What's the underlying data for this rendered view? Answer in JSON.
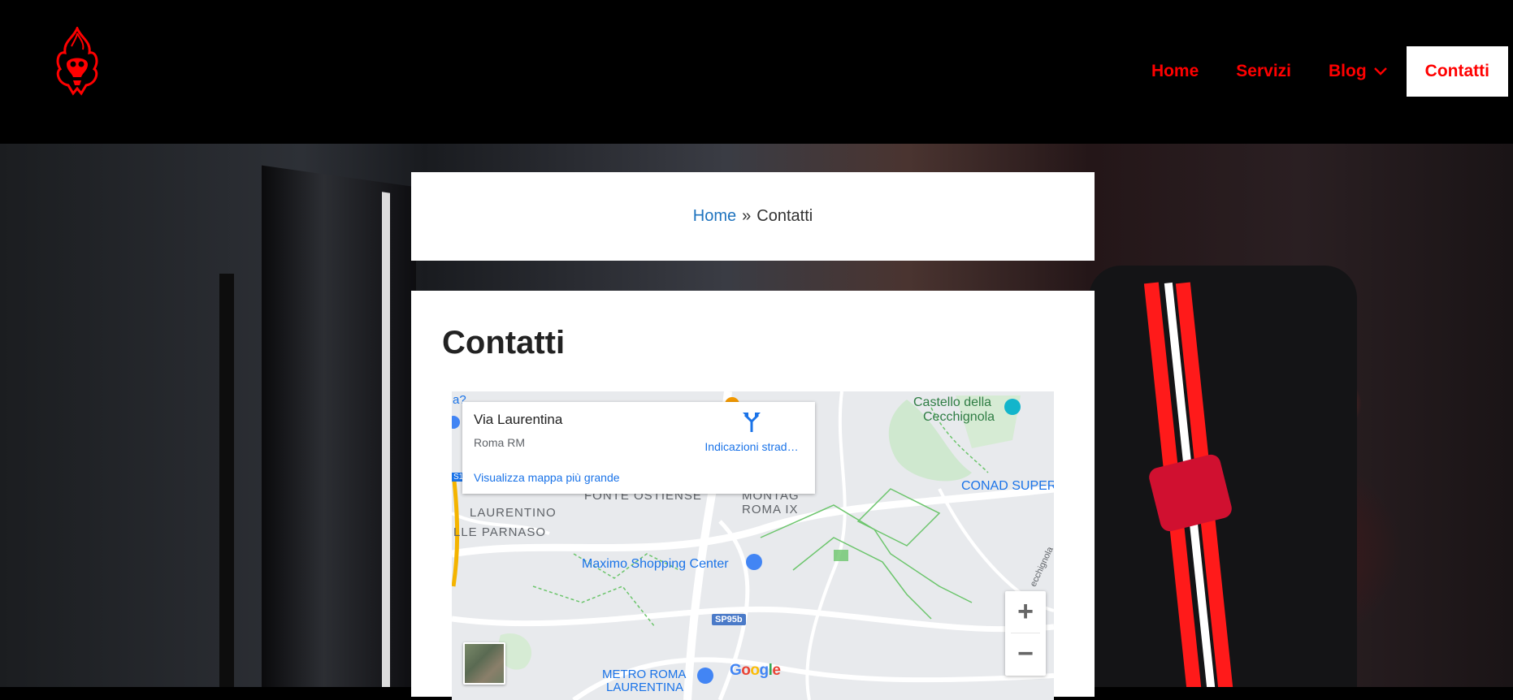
{
  "header": {
    "logo_icon": "flame-skull-logo-icon",
    "nav": {
      "home": "Home",
      "servizi": "Servizi",
      "blog": "Blog",
      "contatti": "Contatti"
    }
  },
  "breadcrumb": {
    "home": "Home",
    "separator": "»",
    "current": "Contatti"
  },
  "page": {
    "title": "Contatti"
  },
  "map": {
    "info": {
      "title": "Via Laurentina",
      "subtitle": "Roma RM",
      "directions": "Indicazioni strad…",
      "larger_map": "Visualizza mappa più grande"
    },
    "labels": {
      "castello": "Castello della",
      "cecchignola": "Cecchignola",
      "conad": "CONAD SUPER",
      "fonte": "FONTE OSTIENSE",
      "montagnola": "MONTAG",
      "roma_ix": "ROMA IX",
      "laurentino": "LAURENTINO",
      "parnaso": "LLE PARNASO",
      "maximo": "Maximo Shopping Center",
      "metro": "METRO ROMA",
      "metro2": "LAURENTINA",
      "sp95b": "SP95b",
      "s1": "S1",
      "a2": "a?",
      "cecchignola_road": "ecchignola"
    },
    "zoom_in": "+",
    "zoom_out": "−",
    "google": "Google",
    "colors": {
      "link": "#1a73e8",
      "park": "#34a853",
      "poi": "#4285f4"
    }
  },
  "theme": {
    "nav_color": "#ff0000",
    "breadcrumb_link": "#1e73be"
  }
}
